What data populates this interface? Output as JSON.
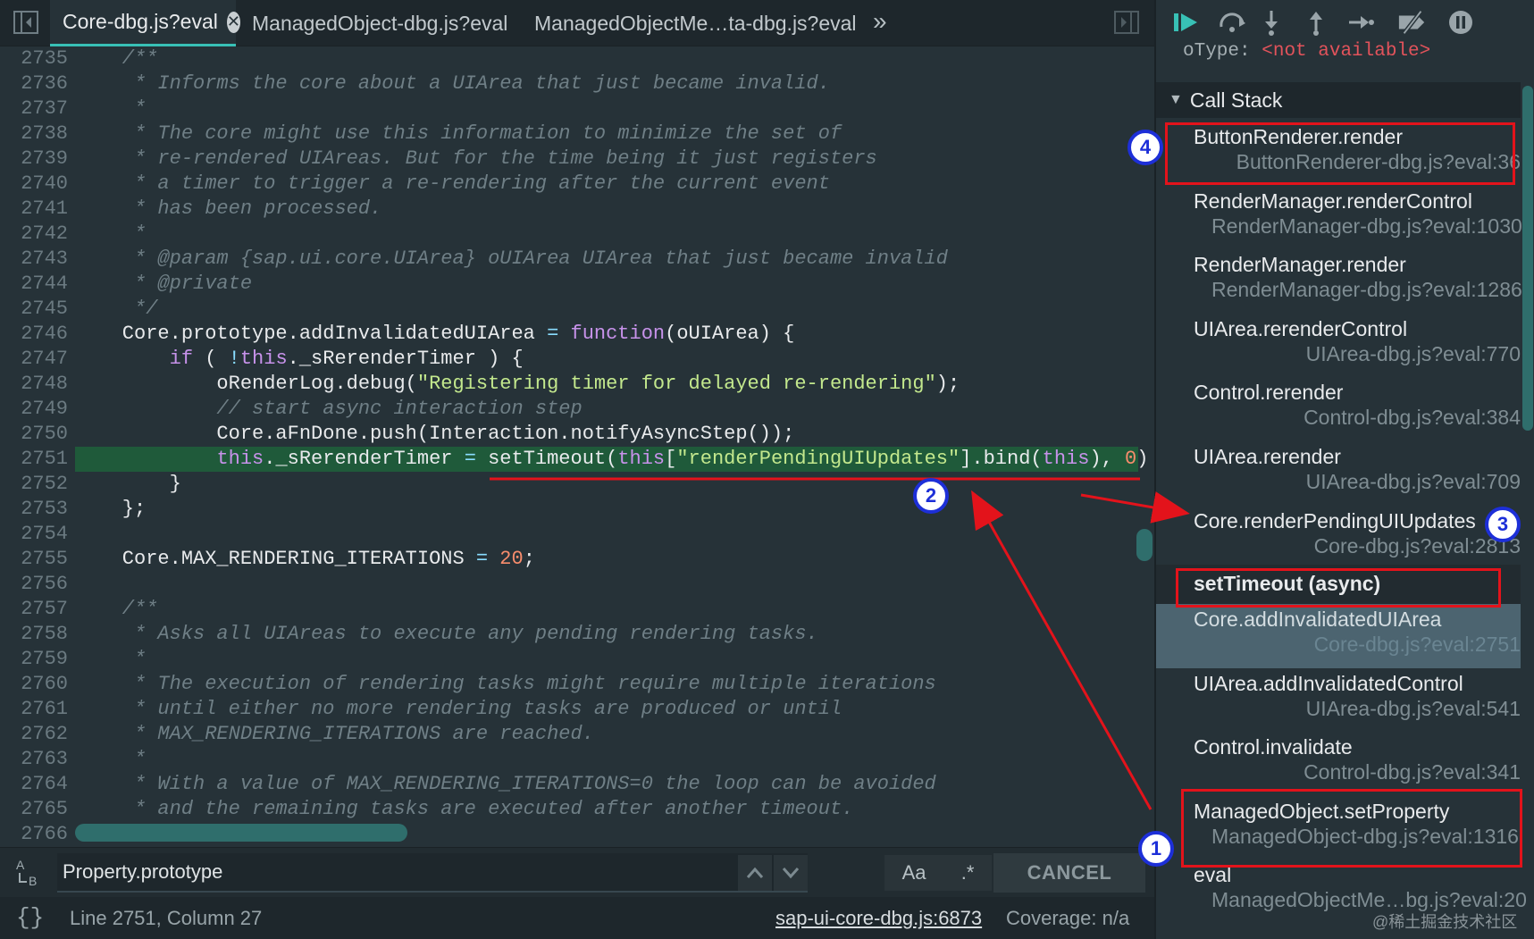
{
  "editor": {
    "tabs": [
      {
        "label": "Core-dbg.js?eval",
        "active": true
      },
      {
        "label": "ManagedObject-dbg.js?eval"
      },
      {
        "label": "ManagedObjectMe…ta-dbg.js?eval"
      }
    ],
    "tab_overflow": "»",
    "close_glyph": "✕",
    "lines": [
      {
        "n": "2735",
        "html": "<span class='c-comment'>    /**</span>"
      },
      {
        "n": "2736",
        "html": "<span class='c-comment'>     * Informs the core about a UIArea that just became invalid.</span>"
      },
      {
        "n": "2737",
        "html": "<span class='c-comment'>     *</span>"
      },
      {
        "n": "2738",
        "html": "<span class='c-comment'>     * The core might use this information to minimize the set of</span>"
      },
      {
        "n": "2739",
        "html": "<span class='c-comment'>     * re-rendered UIAreas. But for the time being it just registers</span>"
      },
      {
        "n": "2740",
        "html": "<span class='c-comment'>     * a timer to trigger a re-rendering after the current event</span>"
      },
      {
        "n": "2741",
        "html": "<span class='c-comment'>     * has been processed.</span>"
      },
      {
        "n": "2742",
        "html": "<span class='c-comment'>     *</span>"
      },
      {
        "n": "2743",
        "html": "<span class='c-comment'>     * @param {sap.ui.core.UIArea} oUIArea UIArea that just became invalid</span>"
      },
      {
        "n": "2744",
        "html": "<span class='c-comment'>     * @private</span>"
      },
      {
        "n": "2745",
        "html": "<span class='c-comment'>     */</span>"
      },
      {
        "n": "2746",
        "html": "    Core.prototype.addInvalidatedUIArea <span class='c-op'>=</span> <span class='c-kw'>function</span>(oUIArea) {"
      },
      {
        "n": "2747",
        "html": "        <span class='c-kw'>if</span> ( <span class='c-op'>!</span><span class='c-kw'>this</span>._sRerenderTimer ) {"
      },
      {
        "n": "2748",
        "html": "            oRenderLog.debug(<span class='c-str'>\"Registering timer for delayed re-rendering\"</span>);"
      },
      {
        "n": "2749",
        "html": "<span class='c-comment'>            // start async interaction step</span>"
      },
      {
        "n": "2750",
        "html": "            Core.aFnDone.push(Interaction.notifyAsyncStep());"
      },
      {
        "n": "2751",
        "html": "            <span class='c-kw'>this</span>._sRerenderTimer <span class='c-op'>=</span> setTimeout(<span class='c-kw'>this</span>[<span class='c-str'>\"renderPendingUIUpdates\"</span>].bind(<span class='c-kw'>this</span>), <span class='c-num'>0</span>)",
        "exec": true
      },
      {
        "n": "2752",
        "html": "        }"
      },
      {
        "n": "2753",
        "html": "    };"
      },
      {
        "n": "2754",
        "html": ""
      },
      {
        "n": "2755",
        "html": "    Core.MAX_RENDERING_ITERATIONS <span class='c-op'>=</span> <span class='c-num'>20</span>;"
      },
      {
        "n": "2756",
        "html": ""
      },
      {
        "n": "2757",
        "html": "<span class='c-comment'>    /**</span>"
      },
      {
        "n": "2758",
        "html": "<span class='c-comment'>     * Asks all UIAreas to execute any pending rendering tasks.</span>"
      },
      {
        "n": "2759",
        "html": "<span class='c-comment'>     *</span>"
      },
      {
        "n": "2760",
        "html": "<span class='c-comment'>     * The execution of rendering tasks might require multiple iterations</span>"
      },
      {
        "n": "2761",
        "html": "<span class='c-comment'>     * until either no more rendering tasks are produced or until</span>"
      },
      {
        "n": "2762",
        "html": "<span class='c-comment'>     * MAX_RENDERING_ITERATIONS are reached.</span>"
      },
      {
        "n": "2763",
        "html": "<span class='c-comment'>     *</span>"
      },
      {
        "n": "2764",
        "html": "<span class='c-comment'>     * With a value of MAX_RENDERING_ITERATIONS=0 the loop can be avoided</span>"
      },
      {
        "n": "2765",
        "html": "<span class='c-comment'>     * and the remaining tasks are executed after another timeout.</span>"
      },
      {
        "n": "2766",
        "html": ""
      }
    ]
  },
  "search": {
    "value": "Property.prototype",
    "icon_glyph": "A\nʟB",
    "up_glyph": "⌃",
    "down_glyph": "⌄",
    "case_label": "Aa",
    "regex_label": ".*",
    "cancel_label": "CANCEL"
  },
  "status": {
    "braces": "{}",
    "position": "Line 2751, Column 27",
    "source_link": "sap-ui-core-dbg.js:6873",
    "coverage": "Coverage: n/a"
  },
  "debugger": {
    "toolbar_glyphs": {
      "resume": "▶",
      "step_over": "↷",
      "step_into": "⇣",
      "step_out": "⇡",
      "step": "→",
      "deactivate": "⧸",
      "pause": "⏸"
    },
    "scope_key": "oType",
    "scope_val": "<not available>",
    "call_stack_label": "Call Stack",
    "frames": [
      {
        "fn": "ButtonRenderer.render",
        "loc": "ButtonRenderer-dbg.js?eval:36"
      },
      {
        "fn": "RenderManager.renderControl",
        "loc": "RenderManager-dbg.js?eval:1030",
        "clip": true
      },
      {
        "fn": "RenderManager.render",
        "loc": "RenderManager-dbg.js?eval:1286",
        "clip": true
      },
      {
        "fn": "UIArea.rerenderControl",
        "loc": "UIArea-dbg.js?eval:770"
      },
      {
        "fn": "Control.rerender",
        "loc": "Control-dbg.js?eval:384"
      },
      {
        "fn": "UIArea.rerender",
        "loc": "UIArea-dbg.js?eval:709"
      },
      {
        "fn": "Core.renderPendingUIUpdates",
        "loc": "Core-dbg.js?eval:2813"
      }
    ],
    "async_label": "setTimeout (async)",
    "frames_after": [
      {
        "fn": "Core.addInvalidatedUIArea",
        "loc": "Core-dbg.js?eval:2751",
        "selected": true
      },
      {
        "fn": "UIArea.addInvalidatedControl",
        "loc": "UIArea-dbg.js?eval:541"
      },
      {
        "fn": "Control.invalidate",
        "loc": "Control-dbg.js?eval:341"
      },
      {
        "fn": "ManagedObject.setProperty",
        "loc": "ManagedObject-dbg.js?eval:1316",
        "clip": true
      },
      {
        "fn": "eval",
        "loc": "ManagedObjectMe…bg.js?eval:20",
        "clip": true
      }
    ],
    "watermark": "@稀土掘金技术社区"
  },
  "annotations": {
    "labels": [
      "1",
      "2",
      "3",
      "4"
    ],
    "box_color": "#e3131b",
    "circle_color": "#1d2fd8"
  }
}
